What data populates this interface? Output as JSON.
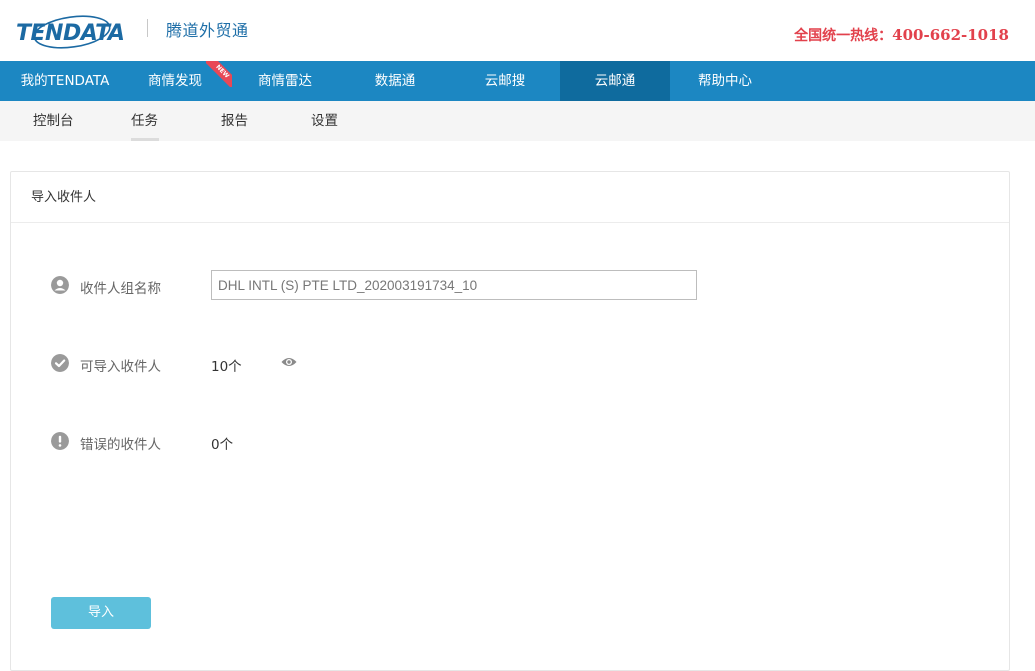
{
  "header": {
    "logo_text": "TENDATA",
    "brand_name": "腾道外贸通",
    "hotline_label": "全国统一热线：",
    "hotline_number": "400-662-1018"
  },
  "main_nav": {
    "items": [
      {
        "label": "我的TENDATA"
      },
      {
        "label": "商情发现",
        "badge": "NEW"
      },
      {
        "label": "商情雷达"
      },
      {
        "label": "数据通"
      },
      {
        "label": "云邮搜"
      },
      {
        "label": "云邮通"
      },
      {
        "label": "帮助中心"
      }
    ],
    "active_index": 5
  },
  "sub_nav": {
    "items": [
      {
        "label": "控制台"
      },
      {
        "label": "任务"
      },
      {
        "label": "报告"
      },
      {
        "label": "设置"
      }
    ],
    "active_index": 1
  },
  "panel": {
    "title": "导入收件人",
    "group_name": {
      "label": "收件人组名称",
      "value": "DHL INTL (S) PTE LTD_202003191734_10",
      "icon": "user-circle-icon"
    },
    "importable": {
      "label": "可导入收件人",
      "value": "10个",
      "icon": "check-circle-icon",
      "action_icon": "eye-icon"
    },
    "errors": {
      "label": "错误的收件人",
      "value": "0个",
      "icon": "exclamation-circle-icon"
    },
    "import_button": "导入"
  },
  "colors": {
    "nav_bg": "#1c87c2",
    "nav_active": "#0f6b9e",
    "hotline": "#e2414c",
    "button": "#5ec0dc",
    "brand": "#1f6fa8"
  }
}
